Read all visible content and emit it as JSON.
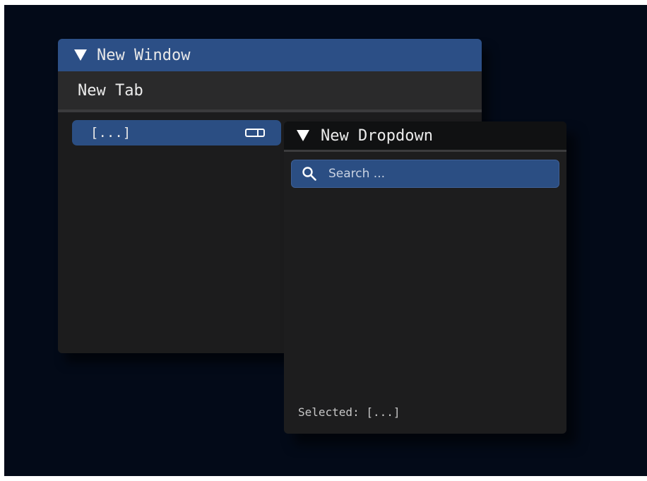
{
  "window": {
    "title": "New Window",
    "tab": "New Tab",
    "combo_value": "[...]"
  },
  "dropdown": {
    "title": "New Dropdown",
    "search_placeholder": "Search ...",
    "selected_text": "Selected: [...]"
  },
  "colors": {
    "background": "#030a18",
    "accent": "#2c4f86",
    "panel": "#1c1c1d"
  },
  "icons": {
    "window_collapse": "triangle-down-icon",
    "dropdown_collapse": "triangle-down-icon",
    "combo_toggle": "dropdown-toggle-icon",
    "search": "search-icon"
  }
}
